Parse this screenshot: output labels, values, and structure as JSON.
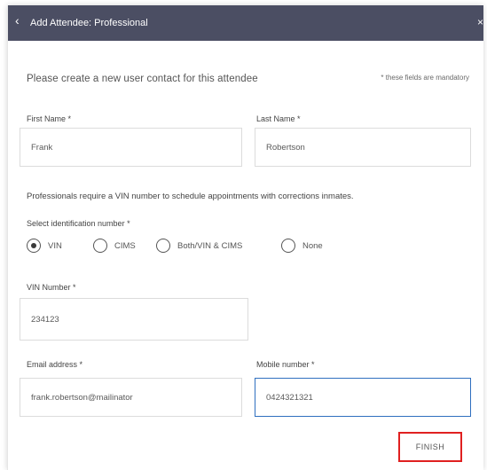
{
  "header": {
    "back_icon": "‹",
    "title": "Add Attendee: Professional",
    "close_icon": "×"
  },
  "intro": {
    "text": "Please create a new user contact for this attendee",
    "mandatory_note": "* these fields are mandatory"
  },
  "first_name": {
    "label": "First Name *",
    "value": "Frank"
  },
  "last_name": {
    "label": "Last Name *",
    "value": "Robertson"
  },
  "info_text": "Professionals require a VIN number to schedule appointments with corrections inmates.",
  "identification": {
    "label": "Select identification number *",
    "options": [
      {
        "label": "VIN",
        "selected": true
      },
      {
        "label": "CIMS",
        "selected": false
      },
      {
        "label": "Both/VIN & CIMS",
        "selected": false
      },
      {
        "label": "None",
        "selected": false
      }
    ]
  },
  "vin_number": {
    "label": "VIN Number *",
    "value": "234123"
  },
  "email": {
    "label": "Email address *",
    "value": "frank.robertson@mailinator"
  },
  "mobile": {
    "label": "Mobile number *",
    "value": "0424321321"
  },
  "finish_button": {
    "label": "FINISH"
  },
  "colors": {
    "header_bg": "#4b4e63",
    "focus_border": "#2f6fbf",
    "highlight_border": "#e02020"
  },
  "icons": {
    "back": "chevron-left-icon",
    "close": "close-icon"
  }
}
